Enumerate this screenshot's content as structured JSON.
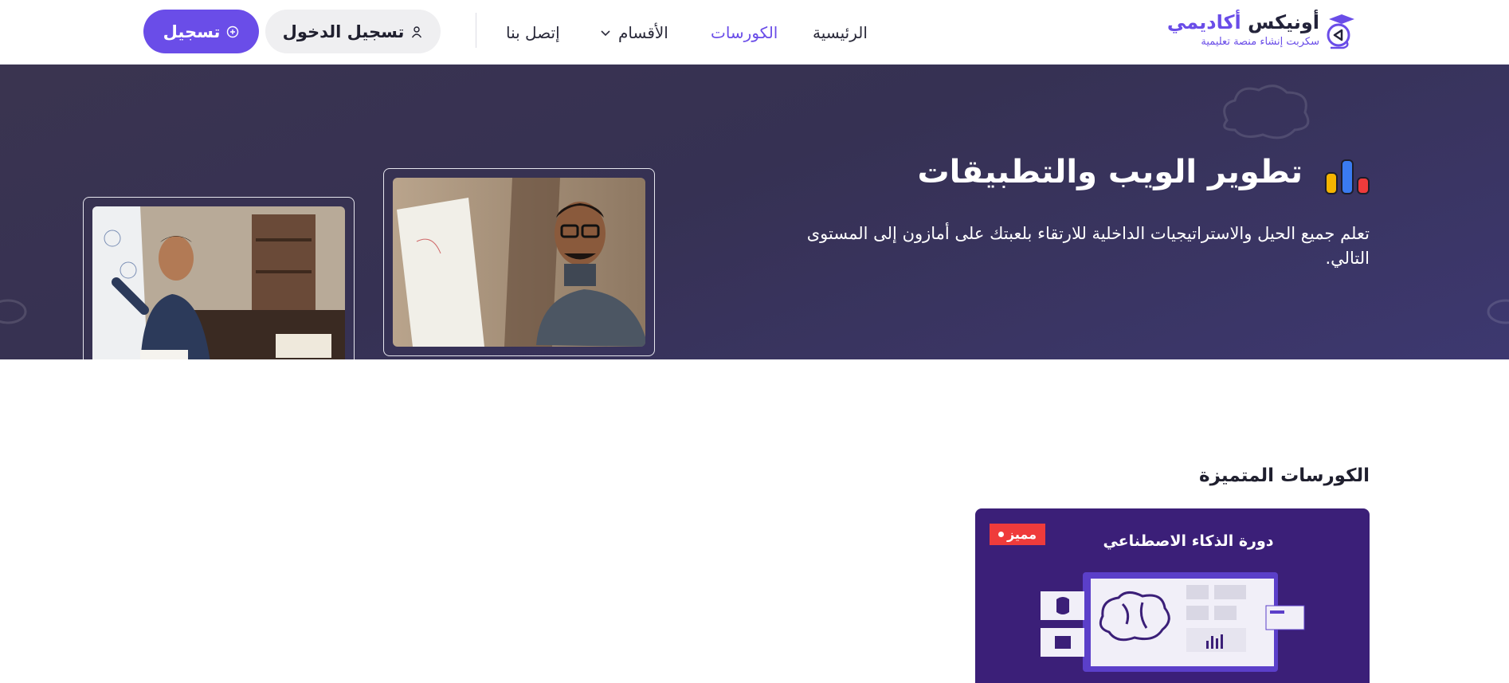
{
  "header": {
    "logo": {
      "title_part1": "أونيكس",
      "title_part2": "أكاديمي",
      "subtitle": "سكربت إنشاء منصة تعليمية",
      "icon": "graduation-play-icon"
    },
    "nav": {
      "home": "الرئيسية",
      "courses": "الكورسات",
      "categories": "الأقسام",
      "contact": "إتصل بنا"
    },
    "login_label": "تسجيل الدخول",
    "register_label": "تسجيل"
  },
  "hero": {
    "title": "تطوير الويب والتطبيقات",
    "description": "تعلم جميع الحيل والاستراتيجيات الداخلية للارتقاء بلعبتك على أمازون إلى المستوى التالي.",
    "icon": "bar-chart-icon"
  },
  "featured": {
    "section_title": "الكورسات المتميزة",
    "card": {
      "badge": "مميز",
      "title": "دورة الذكاء الاصطناعي"
    }
  },
  "colors": {
    "accent": "#6a4de8",
    "hero_bg": "#363153",
    "badge": "#ef3b3b",
    "card_bg": "#3b1f78"
  }
}
